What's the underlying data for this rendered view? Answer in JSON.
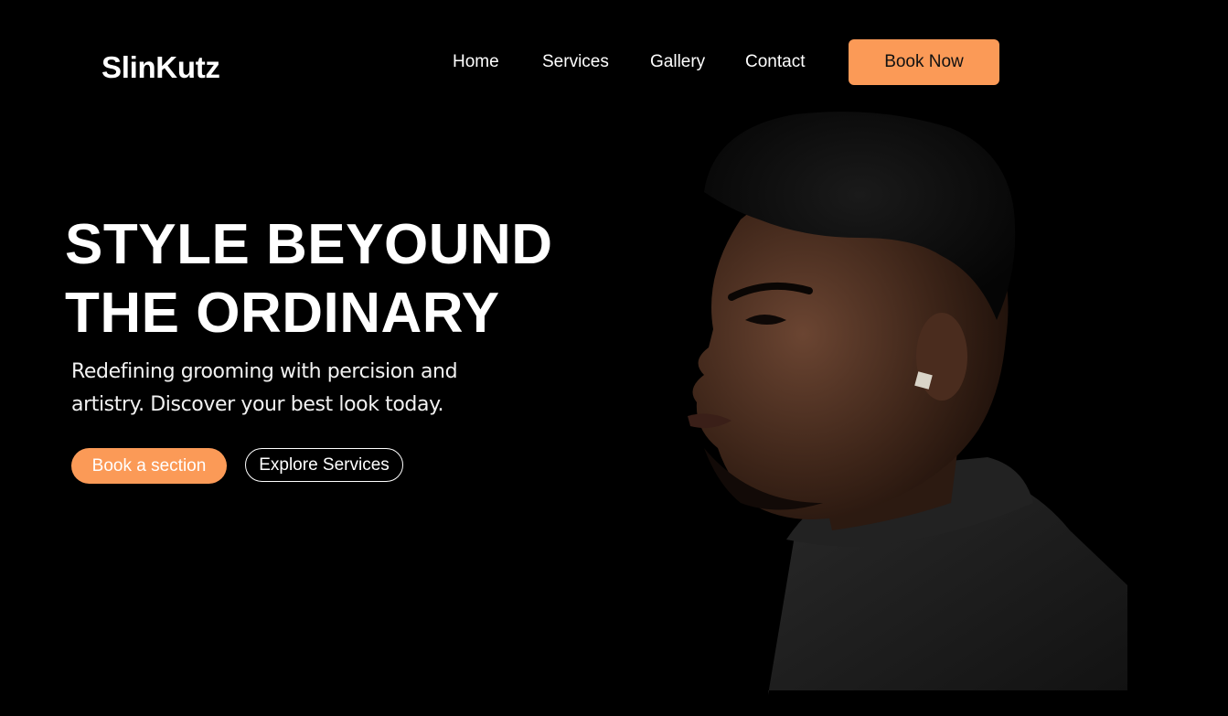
{
  "brand": {
    "name": "SlinKutz",
    "accent_color": "#FB9A57"
  },
  "nav": {
    "items": [
      {
        "label": "Home"
      },
      {
        "label": "Services"
      },
      {
        "label": "Gallery"
      },
      {
        "label": "Contact"
      }
    ],
    "cta_label": "Book Now"
  },
  "hero": {
    "headline_line1": "STYLE BEYOUND",
    "headline_line2": "THE ORDINARY",
    "subtext": "Redefining grooming with percision and artistry. Discover your best look today.",
    "primary_button": "Book a section",
    "secondary_button": "Explore Services",
    "image": {
      "subject": "portrait-man-profile-turtleneck"
    }
  }
}
